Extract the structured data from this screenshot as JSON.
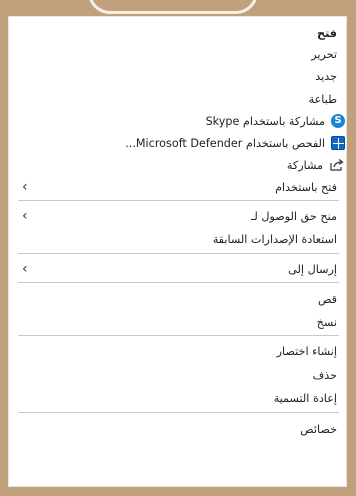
{
  "menu": {
    "open": "فتح",
    "edit": "تحرير",
    "new": "جديد",
    "print": "طباعة",
    "share_skype": "مشاركة باستخدام Skype",
    "scan_defender": "الفحص باستخدام Microsoft Defender...",
    "share": "مشاركة",
    "open_with": "فتح باستخدام",
    "give_access": "منح حق الوصول لـ",
    "restore_versions": "استعادة الإصدارات السابقة",
    "send_to": "إرسال إلى",
    "cut": "قص",
    "copy": "نسخ",
    "create_shortcut": "إنشاء اختصار",
    "delete": "حذف",
    "rename": "إعادة التسمية",
    "properties": "خصائص"
  },
  "icons": {
    "skype": "skype-icon",
    "defender": "defender-icon",
    "share": "share-icon",
    "submenu": "chevron-left-icon"
  },
  "colors": {
    "frame": "#c1a07c",
    "menu_bg": "#ffffff",
    "separator": "#c9c9c9",
    "skype": "#1a84d6",
    "defender": "#0f69c4"
  }
}
